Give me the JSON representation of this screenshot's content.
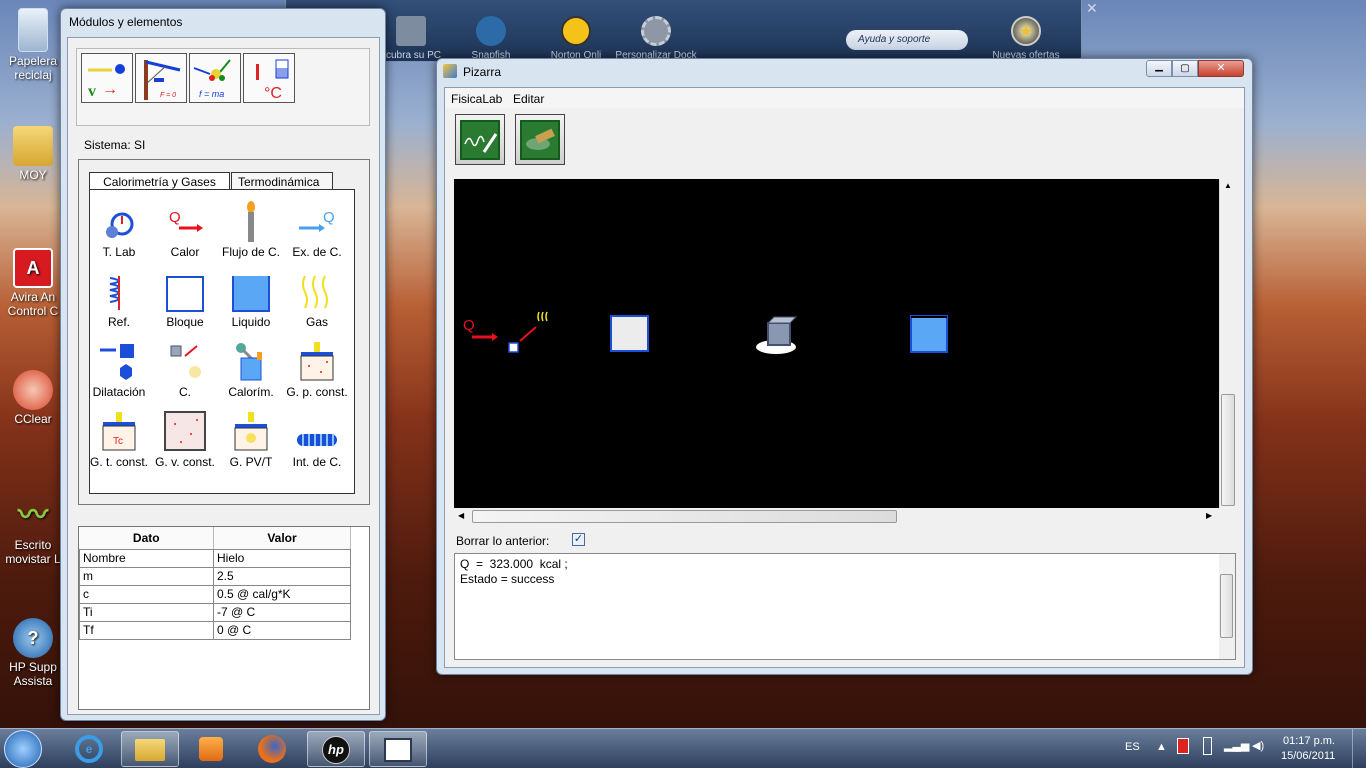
{
  "desktop": {
    "icons": [
      {
        "label": "Papelera de reciclaje",
        "short": "Papelera reciclaj"
      },
      {
        "label": "MOY",
        "short": "MOY"
      },
      {
        "label": "Avira AntiVir Control Center",
        "short": "Avira An Control C"
      },
      {
        "label": "CCleaner",
        "short": "CClear"
      },
      {
        "label": "Escritorio movistar",
        "short": "Escrito movistar L"
      },
      {
        "label": "HP Support Assistant",
        "short": "HP Supp Assista"
      }
    ]
  },
  "gadgets": {
    "items": [
      "scubra su PC",
      "Snapfish",
      "Norton Onli",
      "Personalizar Dock",
      "Nuevas ofertas"
    ],
    "help_placeholder": "Ayuda y soporte"
  },
  "modules": {
    "title": "Módulos y elementos",
    "system_label": "Sistema: SI",
    "toolbar_icons": [
      "velocity-module-icon",
      "statics-module-icon",
      "dynamics-module-icon",
      "thermo-module-icon"
    ],
    "toolbar_text": {
      "v": "v",
      "f0": "F = 0",
      "fma": "f = ma",
      "degc": "°C",
      "q": "Q",
      "tc": "Tc"
    },
    "tabs": [
      "Calorimetría y Gases",
      "Termodinámica"
    ],
    "tools": [
      "T. Lab",
      "Calor",
      "Flujo de C.",
      "Ex. de C.",
      "Ref.",
      "Bloque",
      "Liquido",
      "Gas",
      "Dilatación",
      "C.",
      "Calorím.",
      "G. p. const.",
      "G. t. const.",
      "G. v. const.",
      "G. PV/T",
      "Int. de C."
    ],
    "table": {
      "headers": [
        "Dato",
        "Valor"
      ],
      "rows": [
        [
          "Nombre",
          "Hielo"
        ],
        [
          "m",
          "2.5"
        ],
        [
          "c",
          "0.5 @ cal/g*K"
        ],
        [
          "Ti",
          "-7 @ C"
        ],
        [
          "Tf",
          "0 @ C"
        ]
      ]
    }
  },
  "pizarra": {
    "title": "Pizarra",
    "menu": [
      "FisicaLab",
      "Editar"
    ],
    "buttons": [
      "draw-icon",
      "eraser-icon"
    ],
    "canvas_labels": {
      "q": "Q"
    },
    "clear_label": "Borrar lo anterior:",
    "clear_checked": true,
    "output": [
      "Q  =  323.000  kcal ;",
      "Estado = success"
    ]
  },
  "taskbar": {
    "lang": "ES",
    "time": "01:17 p.m.",
    "date": "15/06/2011"
  },
  "colors": {
    "accent": "#2f6fd6",
    "canvas": "#000000",
    "heat_red": "#e8121e"
  }
}
